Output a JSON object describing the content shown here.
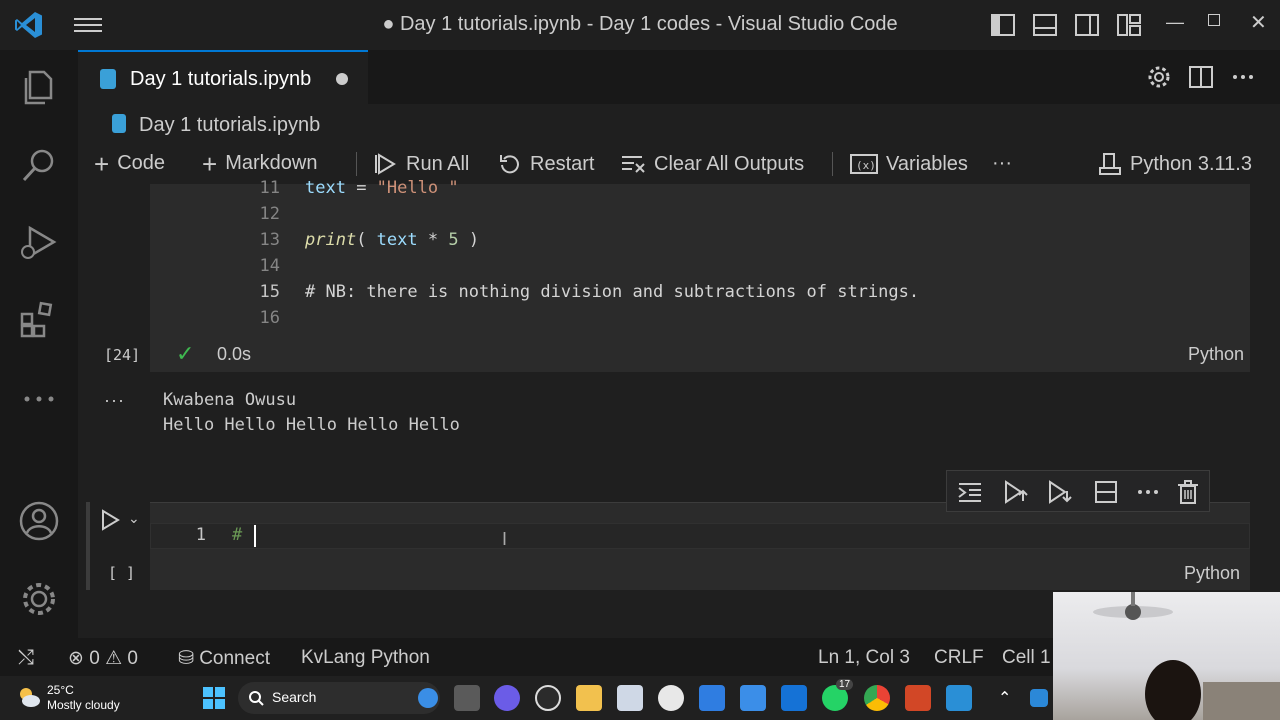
{
  "titlebar": {
    "title": "● Day 1 tutorials.ipynb - Day 1 codes - Visual Studio Code"
  },
  "tab": {
    "label": "Day 1 tutorials.ipynb"
  },
  "breadcrumb": {
    "label": "Day 1 tutorials.ipynb"
  },
  "notebook_toolbar": {
    "code": "Code",
    "markdown": "Markdown",
    "run_all": "Run All",
    "restart": "Restart",
    "clear_all_outputs": "Clear All Outputs",
    "variables": "Variables",
    "more": "···",
    "kernel": "Python 3.11.3"
  },
  "cell1": {
    "lines": [
      {
        "n": "11",
        "text": "text = \"Hello \""
      },
      {
        "n": "12",
        "text": ""
      },
      {
        "n": "13",
        "text": "print( text * 5 )"
      },
      {
        "n": "14",
        "text": ""
      },
      {
        "n": "15",
        "text": "# NB: there is nothing division and subtractions of strings."
      },
      {
        "n": "16",
        "text": ""
      }
    ],
    "exec_count": "[24]",
    "duration": "0.0s",
    "language": "Python"
  },
  "output": {
    "dots": "···",
    "lines": [
      "Kwabena Owusu",
      "Hello Hello Hello Hello Hello"
    ]
  },
  "cell2": {
    "line_number": "1",
    "code": "#",
    "exec_count": "[ ]",
    "language": "Python"
  },
  "statusbar": {
    "errors": "0",
    "warnings": "0",
    "connect": "Connect",
    "language_mode": "KvLang Python",
    "position": "Ln 1, Col 3",
    "eol": "CRLF",
    "cell": "Cell 1"
  },
  "taskbar": {
    "temperature": "25°C",
    "weather": "Mostly cloudy",
    "search": "Search",
    "whatsapp_badge": "17"
  },
  "colors": {
    "accent": "#0078d4",
    "success": "#3fb950",
    "editor_bg": "#1f1f1f",
    "cell_bg": "#2b2b2b"
  }
}
